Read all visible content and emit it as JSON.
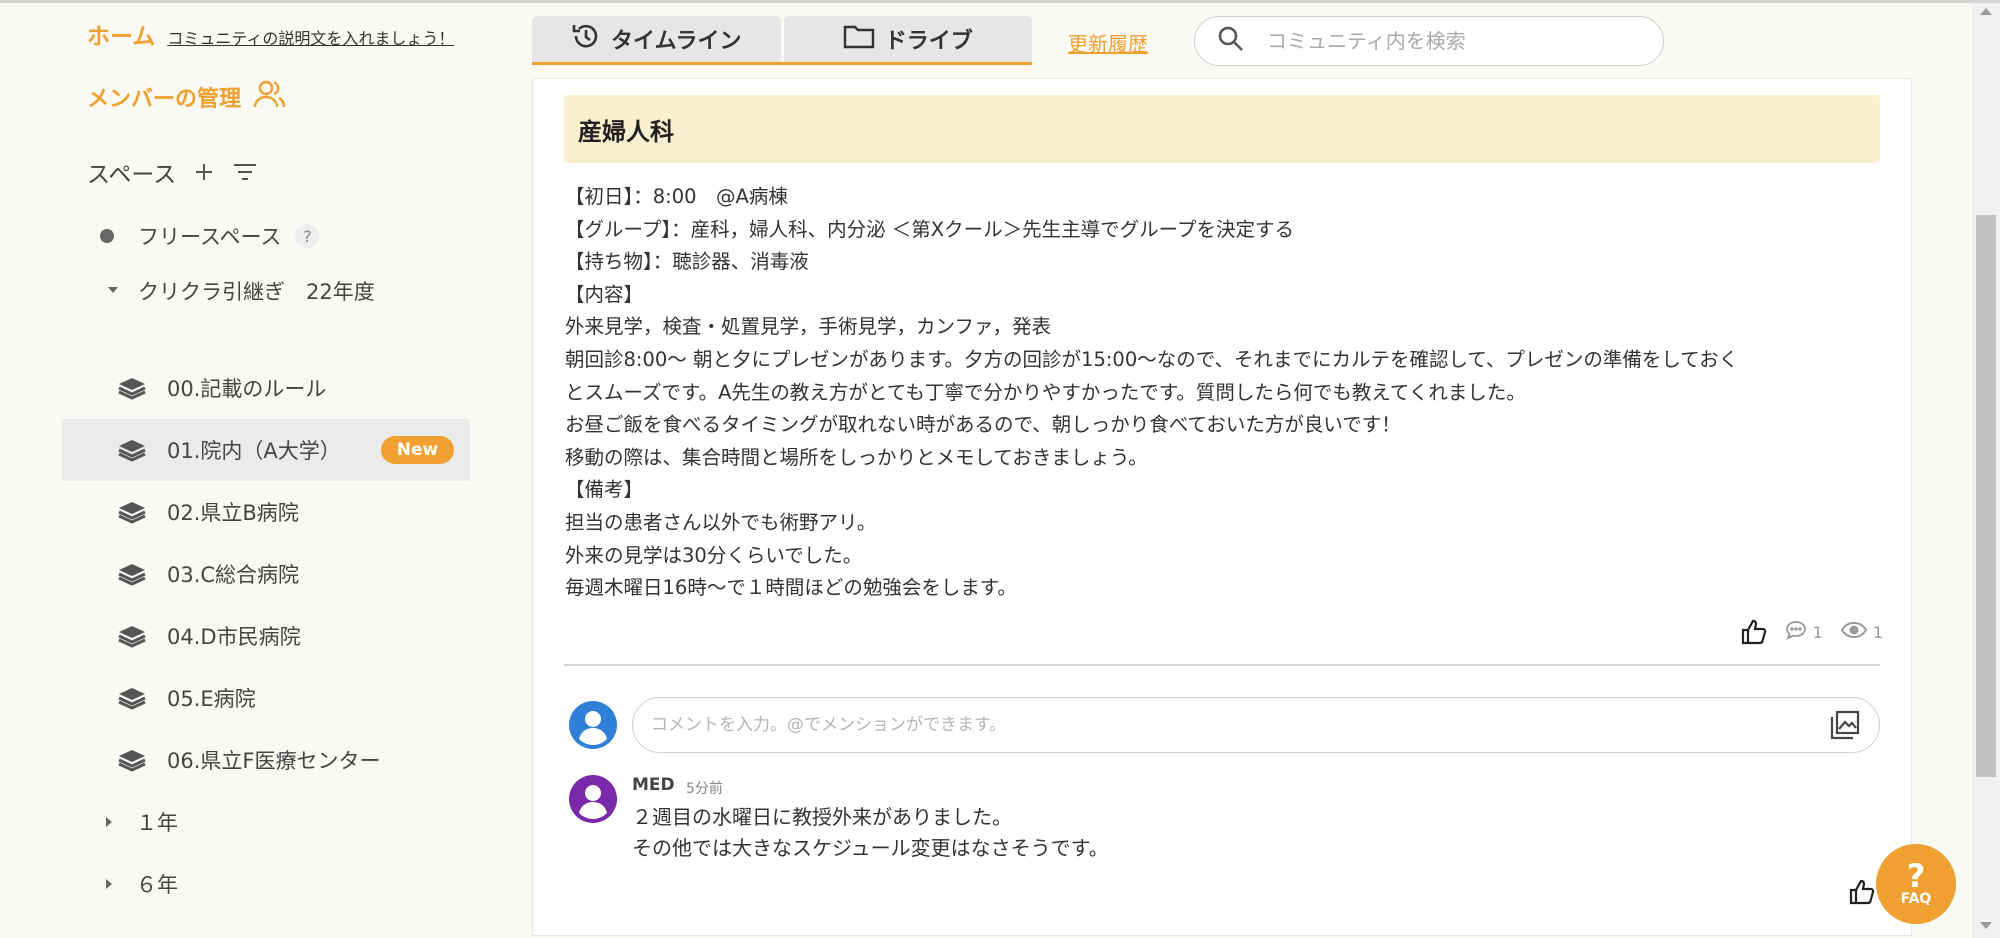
{
  "sidebar": {
    "home_label": "ホーム",
    "description_link": "コミュニティの説明文を入れましょう！",
    "members_label": "メンバーの管理",
    "spaces_label": "スペース",
    "free_space": "フリースペース",
    "help_mark": "?",
    "group": {
      "label": "クリクラ引継ぎ　22年度",
      "items": [
        {
          "label": "00.記載のルール"
        },
        {
          "label": "01.院内（A大学）",
          "badge": "New"
        },
        {
          "label": "02.県立B病院"
        },
        {
          "label": "03.C総合病院"
        },
        {
          "label": "04.D市民病院"
        },
        {
          "label": "05.E病院"
        },
        {
          "label": "06.県立F医療センター"
        }
      ]
    },
    "years": [
      {
        "label": "１年"
      },
      {
        "label": "６年"
      }
    ]
  },
  "tabs": [
    {
      "label": "タイムライン",
      "icon": "clock-icon"
    },
    {
      "label": "ドライブ",
      "icon": "folder-icon"
    }
  ],
  "history_link": "更新履歴",
  "search": {
    "placeholder": "コミュニティ内を検索"
  },
  "post": {
    "title": "産婦人科",
    "lines": [
      "【初日】：8:00　@A病棟",
      "【グループ】：産科，婦人科、内分泌 ＜第Xクール＞先生主導でグループを決定する",
      "【持ち物】：聴診器、消毒液",
      "【内容】",
      "外来見学，検査・処置見学，手術見学，カンファ，発表",
      "朝回診8:00～ 朝と夕にプレゼンがあります。夕方の回診が15:00～なので、それまでにカルテを確認して、プレゼンの準備をしておく",
      "とスムーズです。A先生の教え方がとても丁寧で分かりやすかったです。質問したら何でも教えてくれました。",
      "お昼ご飯を食べるタイミングが取れない時があるので、朝しっかり食べておいた方が良いです！",
      "移動の際は、集合時間と場所をしっかりとメモしておきましょう。",
      "【備考】",
      "担当の患者さん以外でも術野アリ。",
      "外来の見学は30分くらいでした。",
      "毎週木曜日16時～で１時間ほどの勉強会をします。"
    ],
    "comment_count": "1",
    "view_count": "1"
  },
  "comment_box": {
    "placeholder": "コメントを入力。@でメンションができます。"
  },
  "comment": {
    "author": "MED",
    "time": "5分前",
    "lines": [
      "２週目の水曜日に教授外来がありました。",
      "その他では大きなスケジュール変更はなさそうです。"
    ]
  },
  "faq": {
    "mark": "?",
    "label": "FAQ"
  },
  "colors": {
    "accent": "#f0a030",
    "title_bg": "#faf0d0",
    "avatar_blue": "#2f80d6",
    "avatar_purple": "#7a2aa8"
  }
}
